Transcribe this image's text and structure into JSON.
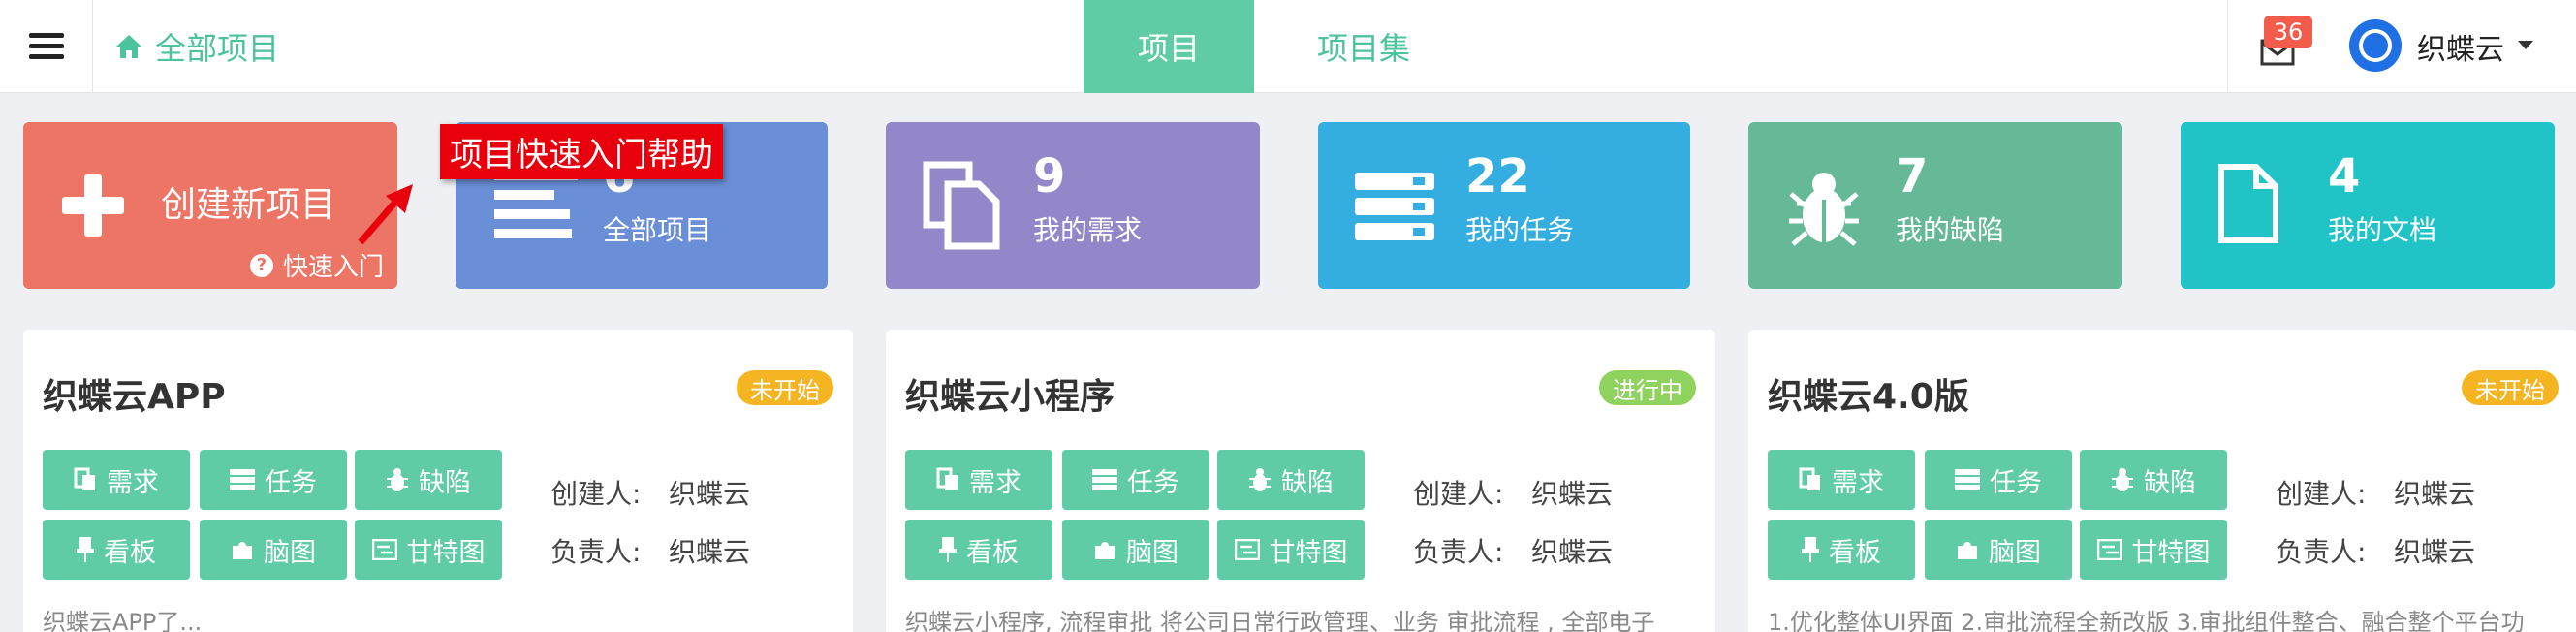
{
  "header": {
    "breadcrumb": "全部项目",
    "tabs": [
      {
        "label": "项目",
        "active": true
      },
      {
        "label": "项目集",
        "active": false
      }
    ],
    "mail_count": "36",
    "username": "织蝶云"
  },
  "colors": {
    "accent": "#5fcca6",
    "create": "#ec7566",
    "all_projects": "#6a8fd6",
    "requirements": "#9387c9",
    "tasks": "#34ade0",
    "defects": "#66b996",
    "docs": "#21c4c6",
    "status_not_started": "#f5b523",
    "status_in_progress": "#8fd25e"
  },
  "tiles": {
    "create": {
      "title": "创建新项目",
      "quick": "快速入门",
      "icon": "plus-icon"
    },
    "help_tip": "项目快速入门帮助",
    "stats": [
      {
        "count": "6",
        "label": "全部项目",
        "icon": "list-icon"
      },
      {
        "count": "9",
        "label": "我的需求",
        "icon": "copy-doc-icon"
      },
      {
        "count": "22",
        "label": "我的任务",
        "icon": "server-icon"
      },
      {
        "count": "7",
        "label": "我的缺陷",
        "icon": "bug-icon"
      },
      {
        "count": "4",
        "label": "我的文档",
        "icon": "file-icon"
      }
    ]
  },
  "card_buttons": [
    {
      "label": "需求",
      "icon": "copy-icon"
    },
    {
      "label": "任务",
      "icon": "server-icon"
    },
    {
      "label": "缺陷",
      "icon": "bug-icon"
    },
    {
      "label": "看板",
      "icon": "pin-icon"
    },
    {
      "label": "脑图",
      "icon": "puzzle-icon"
    },
    {
      "label": "甘特图",
      "icon": "gantt-icon"
    }
  ],
  "meta_labels": {
    "creator": "创建人:",
    "owner": "负责人:"
  },
  "projects": [
    {
      "name": "织蝶云APP",
      "status": "未开始",
      "creator": "织蝶云",
      "owner": "织蝶云",
      "desc": "织蝶云APP了..."
    },
    {
      "name": "织蝶云小程序",
      "status": "进行中",
      "creator": "织蝶云",
      "owner": "织蝶云",
      "desc": "织蝶云小程序, 流程审批 将公司日常行政管理、业务 审批流程 , 全部电子"
    },
    {
      "name": "织蝶云4.0版",
      "status": "未开始",
      "creator": "织蝶云",
      "owner": "织蝶云",
      "desc": "1.优化整体UI界面 2.审批流程全新改版 3.审批组件整合、融合整个平台功"
    }
  ]
}
